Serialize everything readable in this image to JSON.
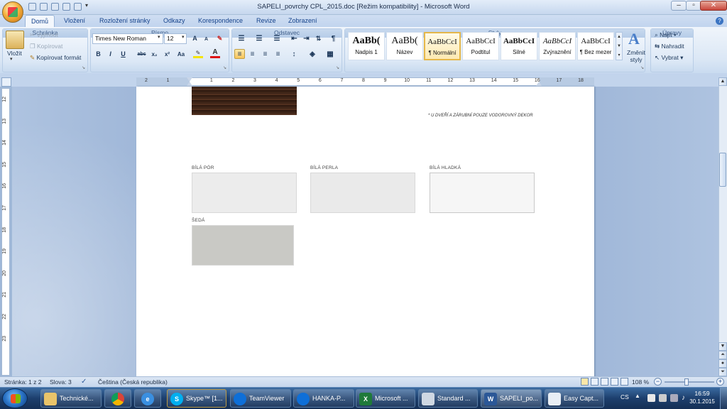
{
  "window": {
    "title": "SAPELI_povrchy CPL_2015.doc [Režim kompatibility] - Microsoft Word",
    "controls": [
      "minimize",
      "maximize",
      "close"
    ]
  },
  "ribbon": {
    "tabs": [
      {
        "label": "Domů",
        "active": true
      },
      {
        "label": "Vložení"
      },
      {
        "label": "Rozložení stránky"
      },
      {
        "label": "Odkazy"
      },
      {
        "label": "Korespondence"
      },
      {
        "label": "Revize"
      },
      {
        "label": "Zobrazení"
      }
    ],
    "clipboard": {
      "paste": "Vložit",
      "cut": "Vyjmout",
      "copy": "Kopírovat",
      "format_painter": "Kopírovat formát",
      "label": "Schránka"
    },
    "font": {
      "family": "Times New Roman",
      "size": "12",
      "label": "Písmo",
      "buttons": [
        "B",
        "I",
        "U",
        "abc",
        "x₂",
        "x²",
        "Aa"
      ]
    },
    "paragraph": {
      "label": "Odstavec"
    },
    "styles": {
      "label": "Styly",
      "items": [
        {
          "sample": "AaBb(",
          "name": "Nadpis 1"
        },
        {
          "sample": "AaBb(",
          "name": "Název"
        },
        {
          "sample": "AaBbCcI",
          "name": "¶ Normální",
          "selected": true
        },
        {
          "sample": "AaBbCcI",
          "name": "Podtitul"
        },
        {
          "sample": "AaBbCcI",
          "name": "Silné"
        },
        {
          "sample": "AaBbCcI",
          "name": "Zvýraznění"
        },
        {
          "sample": "AaBbCcI",
          "name": "¶ Bez mezer"
        }
      ],
      "change": "Změnit styly"
    },
    "editing": {
      "label": "Úpravy",
      "find": "Najít",
      "replace": "Nahradit",
      "select": "Vybrat"
    }
  },
  "ruler": {
    "h_ticks": [
      "2",
      "1",
      "1",
      "2",
      "3",
      "4",
      "5",
      "6",
      "7",
      "8",
      "9",
      "10",
      "11",
      "12",
      "13",
      "14",
      "15",
      "16",
      "17",
      "18"
    ],
    "v_ticks": [
      "12",
      "13",
      "14",
      "15",
      "16",
      "17",
      "18",
      "19",
      "20",
      "21",
      "22",
      "23"
    ]
  },
  "document": {
    "note": "* U DVEŘÍ A ZÁRUBNÍ POUZE VODOROVNÝ DEKOR",
    "swatches": [
      {
        "label": "BÍLÁ PÓR",
        "color": "#ececec"
      },
      {
        "label": "BÍLÁ PERLA",
        "color": "#eaeaea"
      },
      {
        "label": "BÍLÁ HLADKÁ",
        "color": "#f6f6f6"
      },
      {
        "label": "ŠEDÁ",
        "color": "#c9c9c5"
      }
    ],
    "wood_swatch_color": "#3e2518"
  },
  "status": {
    "page": "Stránka: 1 z 2",
    "words": "Slova: 3",
    "language": "Čeština (Česká republika)",
    "zoom": "108 %"
  },
  "taskbar": {
    "items": [
      {
        "label": "Technické...",
        "icon": "folder-icon"
      },
      {
        "label": "",
        "icon": "chrome-icon"
      },
      {
        "label": "",
        "icon": "ie-icon"
      },
      {
        "label": "Skype™ [1...",
        "icon": "skype-icon"
      },
      {
        "label": "TeamViewer",
        "icon": "teamviewer-icon"
      },
      {
        "label": "HANKA-P...",
        "icon": "teamviewer-icon"
      },
      {
        "label": "Microsoft ...",
        "icon": "excel-icon"
      },
      {
        "label": "Standard ...",
        "icon": "window-icon"
      },
      {
        "label": "SAPELI_po...",
        "icon": "word-icon"
      },
      {
        "label": "Easy Capt...",
        "icon": "capture-icon"
      }
    ],
    "tray": {
      "lang": "CS",
      "time": "16:59",
      "date": "30.1.2015"
    }
  }
}
